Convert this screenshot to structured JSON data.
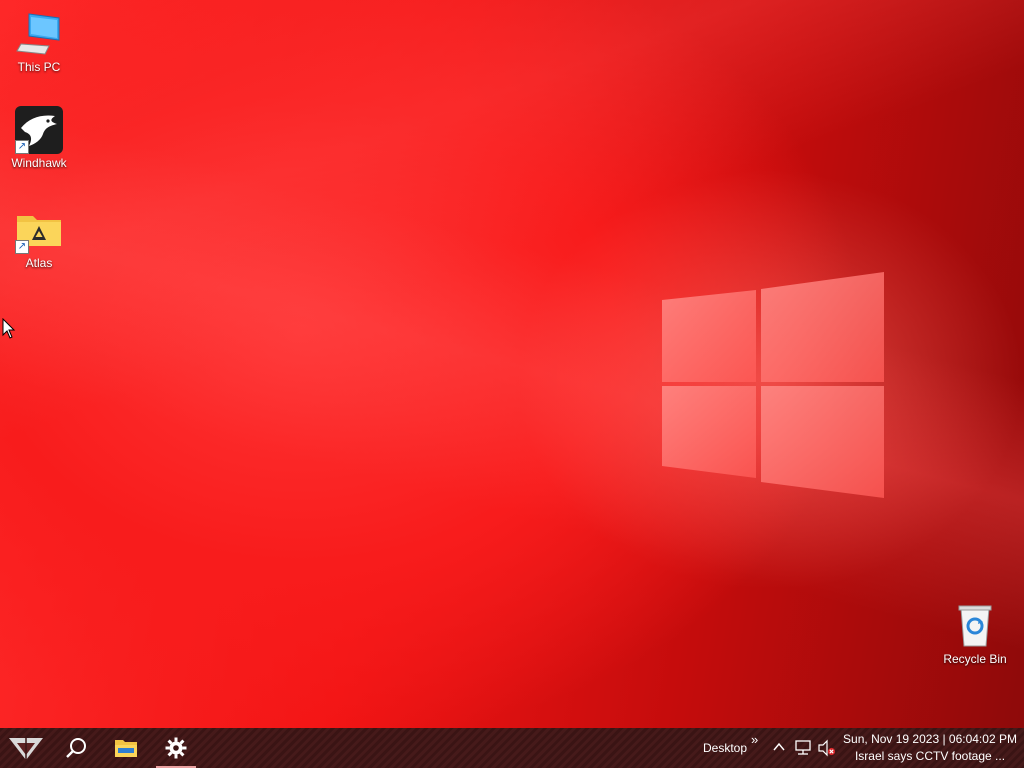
{
  "desktop_icons": {
    "this_pc": {
      "label": "This PC",
      "icon": "computer-icon"
    },
    "windhawk": {
      "label": "Windhawk",
      "icon": "eagle-icon"
    },
    "atlas": {
      "label": "Atlas",
      "icon": "folder-icon"
    },
    "recycle_bin": {
      "label": "Recycle Bin",
      "icon": "recycle-bin-icon"
    }
  },
  "taskbar": {
    "start_icon": "start-icon",
    "search_icon": "search-icon",
    "explorer_icon": "file-explorer-icon",
    "settings_icon": "gear-icon",
    "overflow_glyph": "»",
    "desktop_label": "Desktop",
    "tray_chevron": "^",
    "clock_line1": "Sun, Nov 19 2023 | 06:04:02 PM",
    "clock_line2": "Israel says CCTV footage ..."
  },
  "colors": {
    "wallpaper_accent": "#f21414",
    "taskbar_bg": "#3a1414"
  }
}
